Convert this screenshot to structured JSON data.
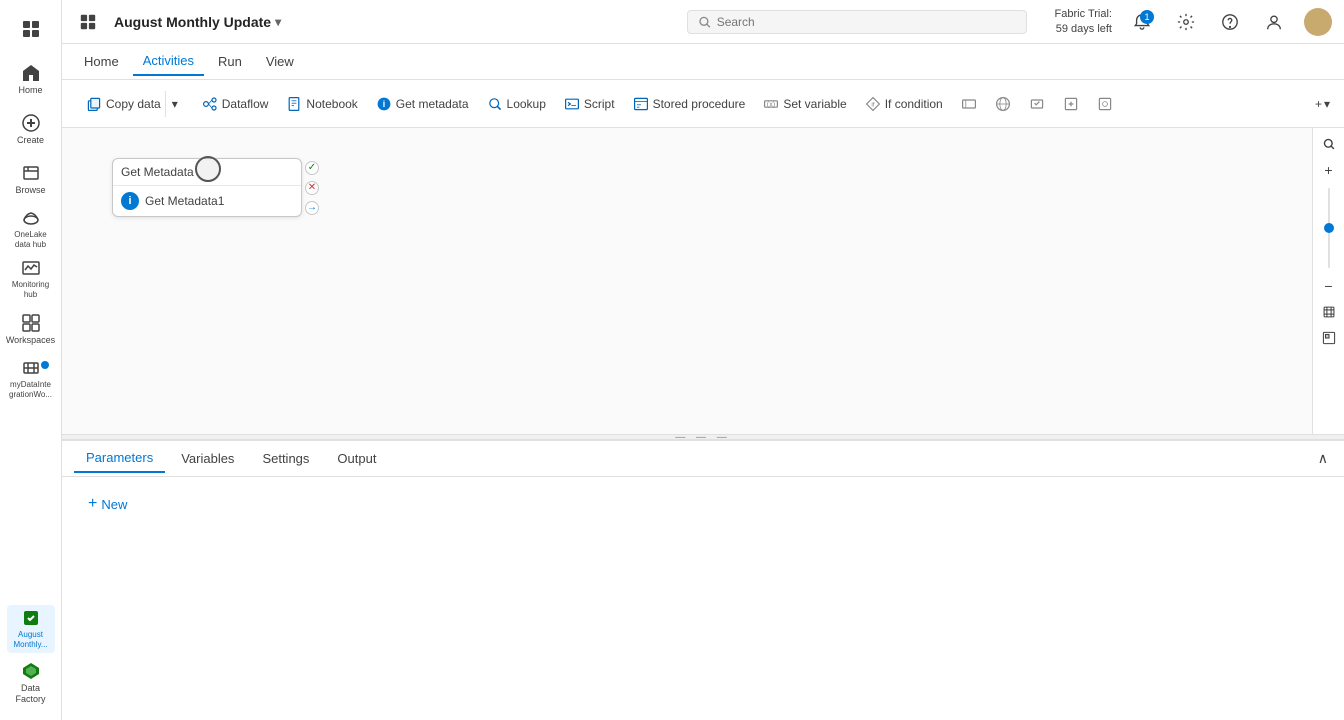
{
  "app": {
    "title": "August Monthly Update",
    "dropdown_icon": "▾"
  },
  "topbar": {
    "grid_icon": "⊞",
    "search_placeholder": "Search",
    "fabric_trial_line1": "Fabric Trial:",
    "fabric_trial_line2": "59 days left",
    "notif_count": "1"
  },
  "menubar": {
    "items": [
      {
        "label": "Home",
        "active": false
      },
      {
        "label": "Activities",
        "active": true
      },
      {
        "label": "Run",
        "active": false
      },
      {
        "label": "View",
        "active": false
      }
    ]
  },
  "toolbar": {
    "copy_data": "Copy data",
    "dataflow": "Dataflow",
    "notebook": "Notebook",
    "get_metadata": "Get metadata",
    "lookup": "Lookup",
    "script": "Script",
    "stored_procedure": "Stored procedure",
    "set_variable": "Set variable",
    "if_condition": "If condition",
    "more_label": "+"
  },
  "canvas": {
    "node": {
      "header": "Get Metadata",
      "activity_name": "Get Metadata1"
    }
  },
  "bottom_panel": {
    "tabs": [
      {
        "label": "Parameters",
        "active": true
      },
      {
        "label": "Variables",
        "active": false
      },
      {
        "label": "Settings",
        "active": false
      },
      {
        "label": "Output",
        "active": false
      }
    ],
    "new_button": "New"
  },
  "sidebar": {
    "items": [
      {
        "label": "Home",
        "icon": "home"
      },
      {
        "label": "Create",
        "icon": "create"
      },
      {
        "label": "Browse",
        "icon": "browse"
      },
      {
        "label": "OneLake data hub",
        "icon": "onelake"
      },
      {
        "label": "Monitoring hub",
        "icon": "monitoring"
      },
      {
        "label": "Workspaces",
        "icon": "workspaces"
      },
      {
        "label": "myDataIntegrationWo...",
        "icon": "integration",
        "has_dot": true
      }
    ],
    "bottom": {
      "label": "August Monthly...",
      "icon": "factory"
    }
  }
}
